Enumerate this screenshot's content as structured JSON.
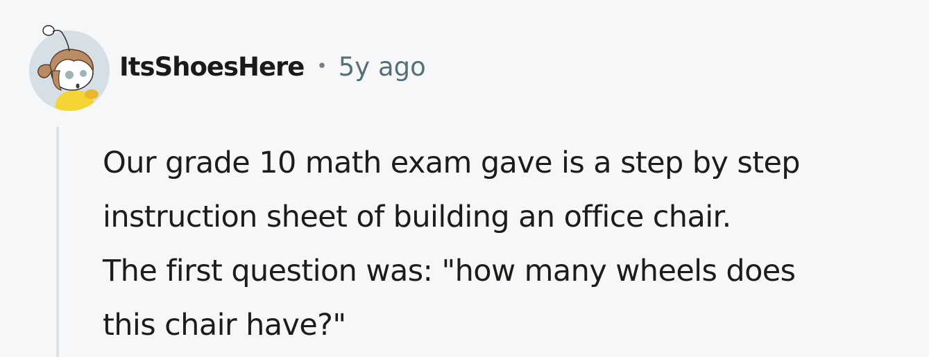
{
  "comment": {
    "author": "ItsShoesHere",
    "separator": "•",
    "time_ago": "5y ago",
    "avatar_icon": "snoo-avatar-icon",
    "body_lines": [
      "Our grade 10 math exam gave is a step by step",
      "instruction sheet of building an office chair.",
      "The first question was: \"how many wheels does",
      "this chair have?\""
    ]
  },
  "colors": {
    "background": "#f6f7f8",
    "username": "#1a1a1b",
    "meta": "#576f76",
    "body_text": "#1c1c1c",
    "thread_line": "#dfe3e6"
  }
}
